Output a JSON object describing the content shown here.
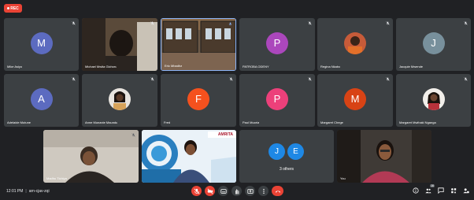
{
  "rec_label": "REC",
  "participants": [
    {
      "name": "Mike Asiyo",
      "initial": "M",
      "avatar_color": "#5c6bc0"
    },
    {
      "name": "Michael Mwita Gichoru",
      "initial": "",
      "avatar_color": ""
    },
    {
      "name": "Eric Mbadha",
      "initial": "",
      "avatar_color": ""
    },
    {
      "name": "PATROBA ODENY",
      "initial": "P",
      "avatar_color": "#ab47bc"
    },
    {
      "name": "Regina Nkabo",
      "initial": "",
      "avatar_color": ""
    },
    {
      "name": "Jacquie Mwende",
      "initial": "J",
      "avatar_color": "#78909c"
    },
    {
      "name": "Adelaide Mutune",
      "initial": "A",
      "avatar_color": "#5c6bc0"
    },
    {
      "name": "Anne Munanie Maundu",
      "initial": "",
      "avatar_color": ""
    },
    {
      "name": "Fred",
      "initial": "F",
      "avatar_color": "#f4511e"
    },
    {
      "name": "Paul Muoria",
      "initial": "P",
      "avatar_color": "#ec407a"
    },
    {
      "name": "Margaret Chege",
      "initial": "M",
      "avatar_color": "#d84315"
    },
    {
      "name": "Margaret Mwihaki Nganga",
      "initial": "",
      "avatar_color": ""
    },
    {
      "name": "Madhu Tichiya",
      "initial": "",
      "avatar_color": ""
    },
    {
      "name": "",
      "initial": "",
      "avatar_color": ""
    },
    {
      "name": "3 others",
      "initials": [
        "J",
        "E"
      ],
      "avatar_color": "#1e88e5"
    },
    {
      "name": "You",
      "initial": "",
      "avatar_color": ""
    }
  ],
  "banner_text": "AMRITA",
  "toolbar": {
    "time": "12:01 PM",
    "meeting_code": "arn-cjav-zqi",
    "people_badge": "16"
  },
  "colors": {
    "background": "#202124",
    "tile": "#3c4043",
    "red": "#ea4335"
  }
}
